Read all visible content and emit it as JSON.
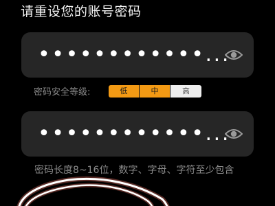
{
  "page": {
    "title": "请重设您的账号密码"
  },
  "password_field": {
    "masked_value": "••••••••••••..."
  },
  "confirm_field": {
    "masked_value": "••••••••••••..."
  },
  "strength": {
    "label": "密码安全等级:",
    "levels": [
      "低",
      "中",
      "高"
    ],
    "active_count": 2,
    "active_color": "#f39a14",
    "inactive_color": "#eeeeee"
  },
  "hint": {
    "text": "密码长度8~16位，数字、字母、字符至少包含"
  },
  "icons": {
    "visibility": "eye-icon"
  },
  "overlay": {
    "scribble_color": "#e0403a"
  }
}
